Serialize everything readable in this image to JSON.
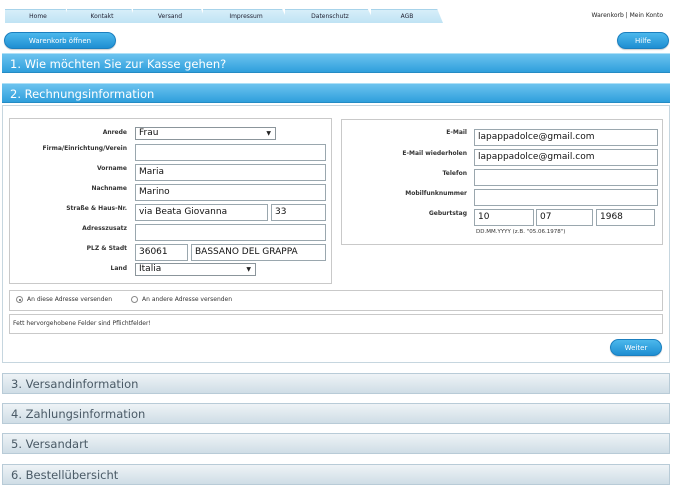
{
  "nav": {
    "tabs": [
      "Home",
      "Kontakt",
      "Versand",
      "Impressum",
      "Datenschutz",
      "AGB"
    ],
    "right": "Warenkorb | Mein Konto"
  },
  "buttons": {
    "cart": "Warenkorb öffnen",
    "help": "Hilfe",
    "next": "Weiter"
  },
  "sections": {
    "s1": "1. Wie möchten Sie zur Kasse gehen?",
    "s2": "2. Rechnungsinformation",
    "s3": "3. Versandinformation",
    "s4": "4. Zahlungsinformation",
    "s5": "5. Versandart",
    "s6": "6. Bestellübersicht"
  },
  "billing": {
    "labels": {
      "salutation": "Anrede",
      "company": "Firma/Einrichtung/Verein",
      "firstname": "Vorname",
      "lastname": "Nachname",
      "street": "Straße & Haus-Nr.",
      "address_extra": "Adresszusatz",
      "zip_city": "PLZ & Stadt",
      "country": "Land"
    },
    "values": {
      "salutation": "Frau",
      "company": "",
      "firstname": "Maria",
      "lastname": "Marino",
      "street": "via Beata Giovanna",
      "house_no": "33",
      "address_extra": "",
      "zip": "36061",
      "city": "BASSANO DEL GRAPPA",
      "country": "Italia"
    }
  },
  "contact": {
    "labels": {
      "email": "E-Mail",
      "email_repeat": "E-Mail wiederholen",
      "phone": "Telefon",
      "mobile": "Mobilfunknummer",
      "birthday": "Geburtstag"
    },
    "values": {
      "email": "lapappadolce@gmail.com",
      "email_repeat": "lapappadolce@gmail.com",
      "phone": "",
      "mobile": "",
      "day": "10",
      "month": "07",
      "year": "1968"
    },
    "birthday_hint": "DD.MM.YYYY (z.B. \"05.06.1978\")"
  },
  "shipping_choice": {
    "option1": "An diese Adresse versenden",
    "option2": "An andere Adresse versenden",
    "selected": "option1"
  },
  "required_note": "Fett hervorgehobene Felder sind Pflichtfelder!"
}
